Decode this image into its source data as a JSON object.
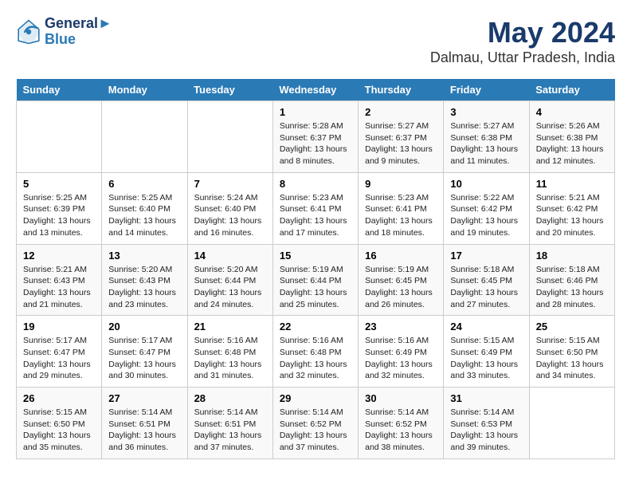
{
  "header": {
    "logo_line1": "General",
    "logo_line2": "Blue",
    "title": "May 2024",
    "subtitle": "Dalmau, Uttar Pradesh, India"
  },
  "days_of_week": [
    "Sunday",
    "Monday",
    "Tuesday",
    "Wednesday",
    "Thursday",
    "Friday",
    "Saturday"
  ],
  "weeks": [
    [
      {
        "day": "",
        "info": ""
      },
      {
        "day": "",
        "info": ""
      },
      {
        "day": "",
        "info": ""
      },
      {
        "day": "1",
        "info": "Sunrise: 5:28 AM\nSunset: 6:37 PM\nDaylight: 13 hours\nand 8 minutes."
      },
      {
        "day": "2",
        "info": "Sunrise: 5:27 AM\nSunset: 6:37 PM\nDaylight: 13 hours\nand 9 minutes."
      },
      {
        "day": "3",
        "info": "Sunrise: 5:27 AM\nSunset: 6:38 PM\nDaylight: 13 hours\nand 11 minutes."
      },
      {
        "day": "4",
        "info": "Sunrise: 5:26 AM\nSunset: 6:38 PM\nDaylight: 13 hours\nand 12 minutes."
      }
    ],
    [
      {
        "day": "5",
        "info": "Sunrise: 5:25 AM\nSunset: 6:39 PM\nDaylight: 13 hours\nand 13 minutes."
      },
      {
        "day": "6",
        "info": "Sunrise: 5:25 AM\nSunset: 6:40 PM\nDaylight: 13 hours\nand 14 minutes."
      },
      {
        "day": "7",
        "info": "Sunrise: 5:24 AM\nSunset: 6:40 PM\nDaylight: 13 hours\nand 16 minutes."
      },
      {
        "day": "8",
        "info": "Sunrise: 5:23 AM\nSunset: 6:41 PM\nDaylight: 13 hours\nand 17 minutes."
      },
      {
        "day": "9",
        "info": "Sunrise: 5:23 AM\nSunset: 6:41 PM\nDaylight: 13 hours\nand 18 minutes."
      },
      {
        "day": "10",
        "info": "Sunrise: 5:22 AM\nSunset: 6:42 PM\nDaylight: 13 hours\nand 19 minutes."
      },
      {
        "day": "11",
        "info": "Sunrise: 5:21 AM\nSunset: 6:42 PM\nDaylight: 13 hours\nand 20 minutes."
      }
    ],
    [
      {
        "day": "12",
        "info": "Sunrise: 5:21 AM\nSunset: 6:43 PM\nDaylight: 13 hours\nand 21 minutes."
      },
      {
        "day": "13",
        "info": "Sunrise: 5:20 AM\nSunset: 6:43 PM\nDaylight: 13 hours\nand 23 minutes."
      },
      {
        "day": "14",
        "info": "Sunrise: 5:20 AM\nSunset: 6:44 PM\nDaylight: 13 hours\nand 24 minutes."
      },
      {
        "day": "15",
        "info": "Sunrise: 5:19 AM\nSunset: 6:44 PM\nDaylight: 13 hours\nand 25 minutes."
      },
      {
        "day": "16",
        "info": "Sunrise: 5:19 AM\nSunset: 6:45 PM\nDaylight: 13 hours\nand 26 minutes."
      },
      {
        "day": "17",
        "info": "Sunrise: 5:18 AM\nSunset: 6:45 PM\nDaylight: 13 hours\nand 27 minutes."
      },
      {
        "day": "18",
        "info": "Sunrise: 5:18 AM\nSunset: 6:46 PM\nDaylight: 13 hours\nand 28 minutes."
      }
    ],
    [
      {
        "day": "19",
        "info": "Sunrise: 5:17 AM\nSunset: 6:47 PM\nDaylight: 13 hours\nand 29 minutes."
      },
      {
        "day": "20",
        "info": "Sunrise: 5:17 AM\nSunset: 6:47 PM\nDaylight: 13 hours\nand 30 minutes."
      },
      {
        "day": "21",
        "info": "Sunrise: 5:16 AM\nSunset: 6:48 PM\nDaylight: 13 hours\nand 31 minutes."
      },
      {
        "day": "22",
        "info": "Sunrise: 5:16 AM\nSunset: 6:48 PM\nDaylight: 13 hours\nand 32 minutes."
      },
      {
        "day": "23",
        "info": "Sunrise: 5:16 AM\nSunset: 6:49 PM\nDaylight: 13 hours\nand 32 minutes."
      },
      {
        "day": "24",
        "info": "Sunrise: 5:15 AM\nSunset: 6:49 PM\nDaylight: 13 hours\nand 33 minutes."
      },
      {
        "day": "25",
        "info": "Sunrise: 5:15 AM\nSunset: 6:50 PM\nDaylight: 13 hours\nand 34 minutes."
      }
    ],
    [
      {
        "day": "26",
        "info": "Sunrise: 5:15 AM\nSunset: 6:50 PM\nDaylight: 13 hours\nand 35 minutes."
      },
      {
        "day": "27",
        "info": "Sunrise: 5:14 AM\nSunset: 6:51 PM\nDaylight: 13 hours\nand 36 minutes."
      },
      {
        "day": "28",
        "info": "Sunrise: 5:14 AM\nSunset: 6:51 PM\nDaylight: 13 hours\nand 37 minutes."
      },
      {
        "day": "29",
        "info": "Sunrise: 5:14 AM\nSunset: 6:52 PM\nDaylight: 13 hours\nand 37 minutes."
      },
      {
        "day": "30",
        "info": "Sunrise: 5:14 AM\nSunset: 6:52 PM\nDaylight: 13 hours\nand 38 minutes."
      },
      {
        "day": "31",
        "info": "Sunrise: 5:14 AM\nSunset: 6:53 PM\nDaylight: 13 hours\nand 39 minutes."
      },
      {
        "day": "",
        "info": ""
      }
    ]
  ]
}
